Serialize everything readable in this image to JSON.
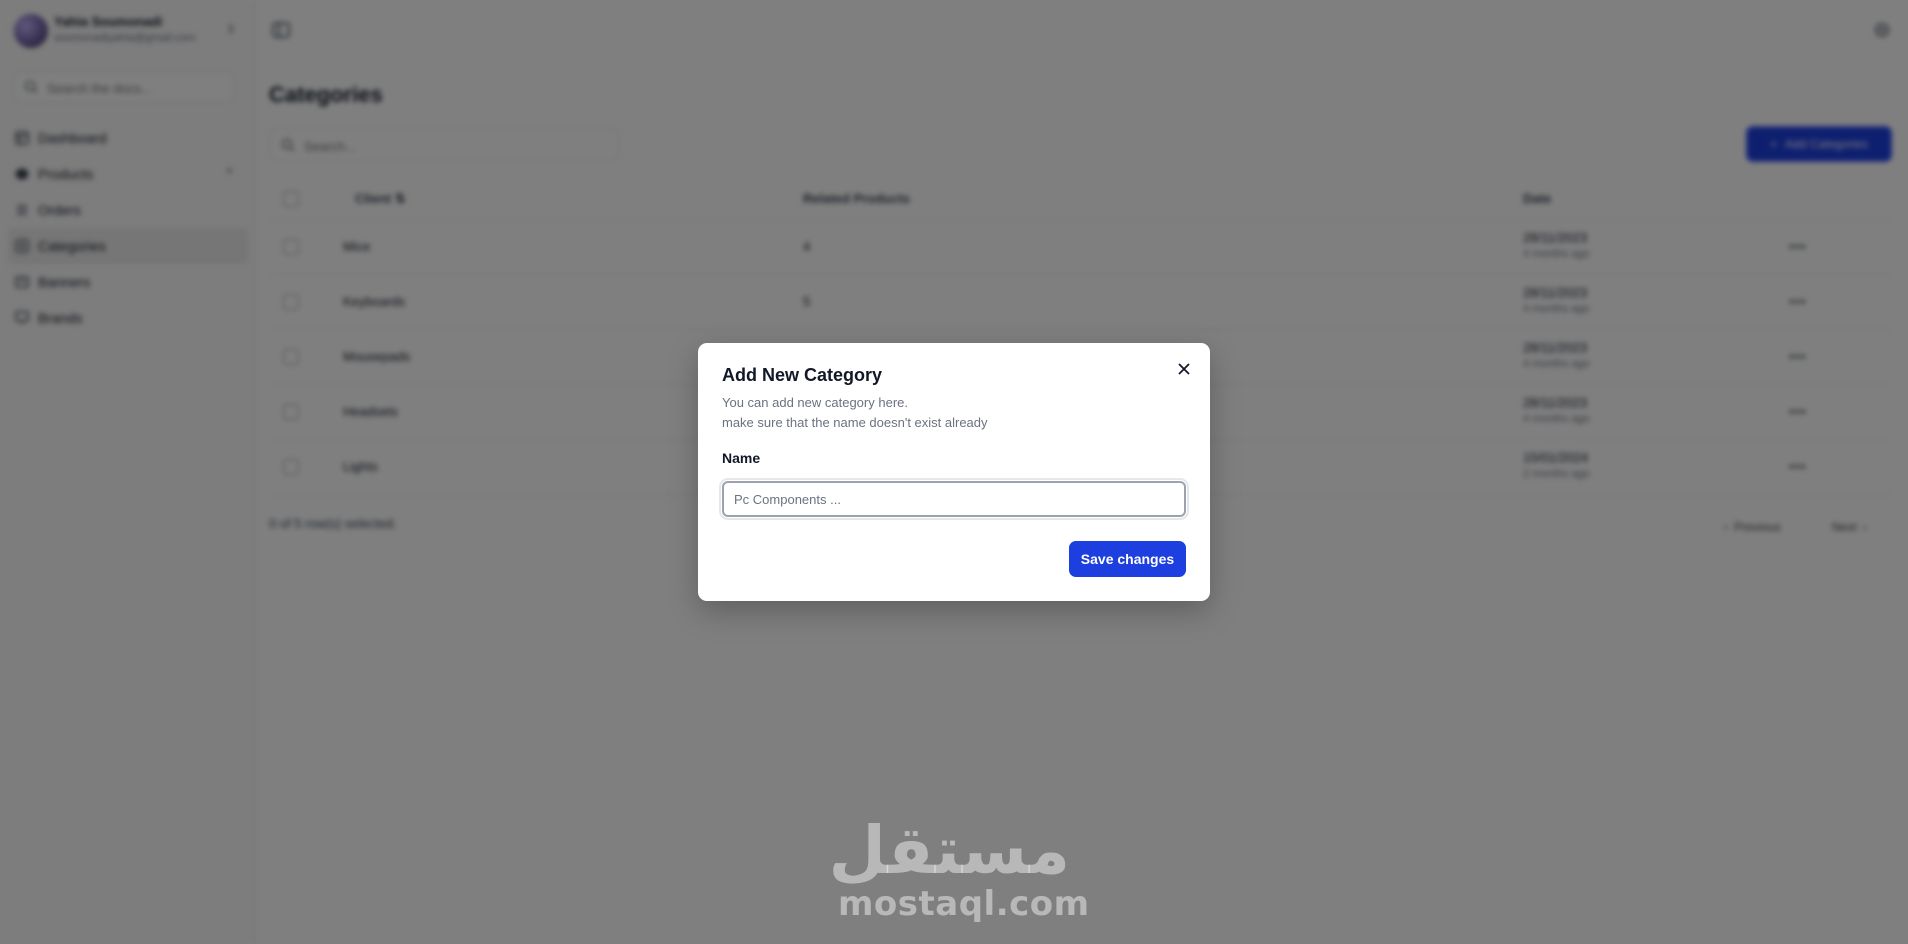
{
  "sidebar": {
    "user": {
      "name": "Yahia Soumonadi",
      "email": "soumonadiyahia@gmail.com"
    },
    "search_placeholder": "Search the docs...",
    "items": [
      {
        "label": "Dashboard",
        "icon": "dashboard-icon"
      },
      {
        "label": "Products",
        "icon": "box-icon"
      },
      {
        "label": "Orders",
        "icon": "orders-icon"
      },
      {
        "label": "Categories",
        "icon": "categories-icon"
      },
      {
        "label": "Banners",
        "icon": "banners-icon"
      },
      {
        "label": "Brands",
        "icon": "brands-icon"
      }
    ]
  },
  "main": {
    "title": "Categories",
    "filter_placeholder": "Search...",
    "add_button_label": "Add Categories",
    "table": {
      "headers": {
        "name": "Client",
        "related": "Related Products",
        "date": "Date"
      },
      "rows": [
        {
          "name": "Mice",
          "related": "4",
          "date": "28/11/2023",
          "ago": "4 months ago"
        },
        {
          "name": "Keyboards",
          "related": "5",
          "date": "28/11/2023",
          "ago": "4 months ago"
        },
        {
          "name": "Mousepads",
          "related": "",
          "date": "28/11/2023",
          "ago": "4 months ago"
        },
        {
          "name": "Headsets",
          "related": "",
          "date": "28/11/2023",
          "ago": "4 months ago"
        },
        {
          "name": "Lights",
          "related": "",
          "date": "15/01/2024",
          "ago": "2 months ago"
        }
      ]
    },
    "selected_info": "0 of 5 row(s) selected.",
    "pager": {
      "previous": "Previous",
      "next": "Next"
    }
  },
  "modal": {
    "title": "Add New Category",
    "description_line1": "You can add new category here.",
    "description_line2": "make sure that the name doesn't exist already",
    "field_label": "Name",
    "input_placeholder": "Pc Components ...",
    "input_value": "",
    "save_label": "Save changes"
  },
  "watermark": {
    "arabic": "مستقل",
    "latin": "mostaql.com"
  },
  "colors": {
    "primary": "#1d3fe0",
    "overlay": "rgba(0,0,0,0.5)"
  }
}
